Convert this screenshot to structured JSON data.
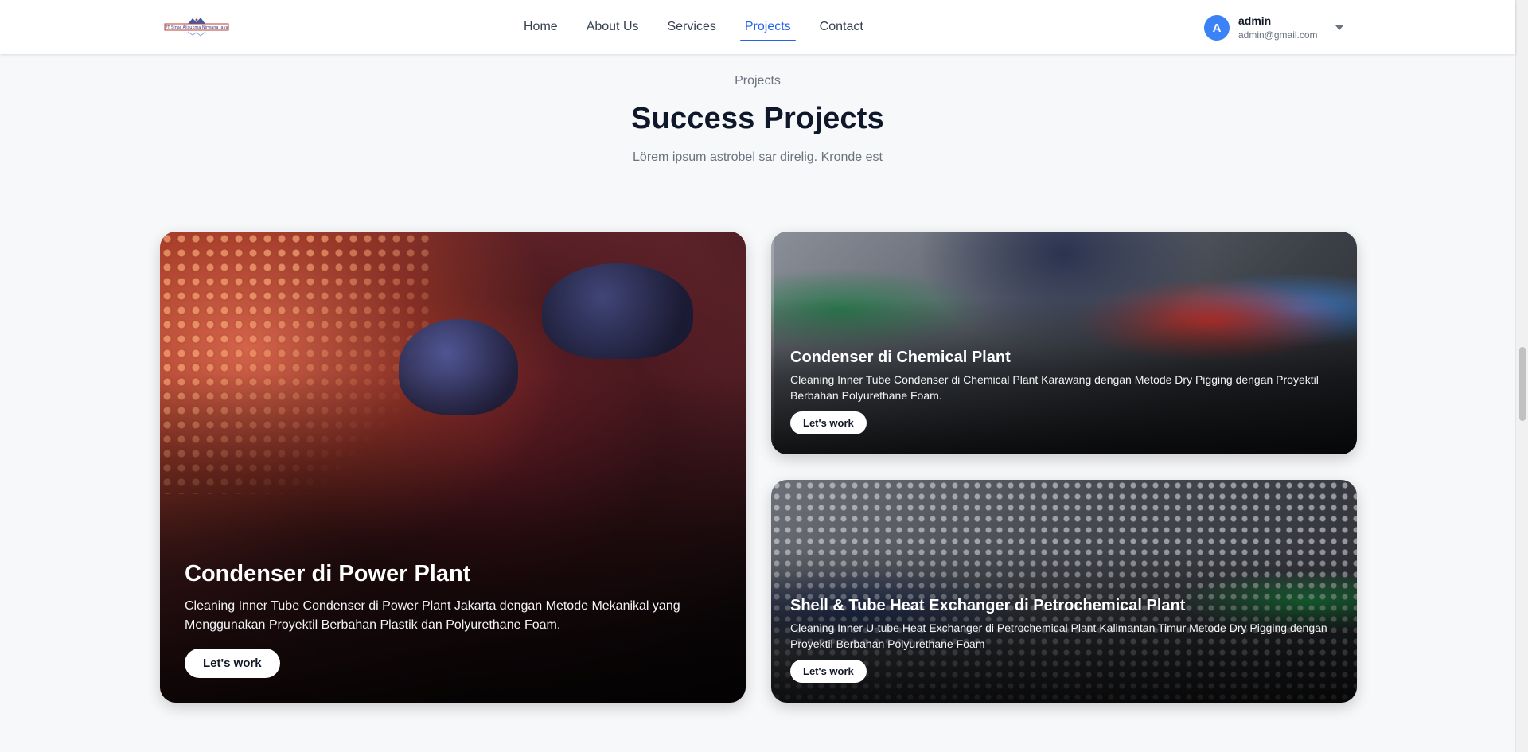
{
  "header": {
    "logo_text": "PT Sinar Ajisukma Nirwana Jaya",
    "nav": [
      {
        "label": "Home",
        "active": false
      },
      {
        "label": "About Us",
        "active": false
      },
      {
        "label": "Services",
        "active": false
      },
      {
        "label": "Projects",
        "active": true
      },
      {
        "label": "Contact",
        "active": false
      }
    ],
    "user": {
      "initial": "A",
      "name": "admin",
      "email": "admin@gmail.com"
    },
    "accent_color": "#2563eb"
  },
  "section": {
    "eyebrow": "Projects",
    "title": "Success Projects",
    "subtitle": "Lörem ipsum astrobel sar direlig. Kronde est"
  },
  "projects": [
    {
      "title": "Condenser di Power Plant",
      "description": "Cleaning Inner Tube Condenser di Power Plant Jakarta dengan Metode Mekanikal yang Menggunakan Proyektil Berbahan Plastik dan Polyurethane Foam.",
      "button": "Let's work"
    },
    {
      "title": "Condenser di Chemical Plant",
      "description": "Cleaning Inner Tube Condenser di Chemical Plant Karawang dengan Metode Dry Pigging dengan Proyektil Berbahan Polyurethane Foam.",
      "button": "Let's work"
    },
    {
      "title": "Shell & Tube Heat Exchanger di Petrochemical Plant",
      "description": "Cleaning Inner U-tube Heat Exchanger di Petrochemical Plant Kalimantan Timur Metode Dry Pigging dengan Proyektil Berbahan Polyurethane Foam",
      "button": "Let's work"
    }
  ]
}
